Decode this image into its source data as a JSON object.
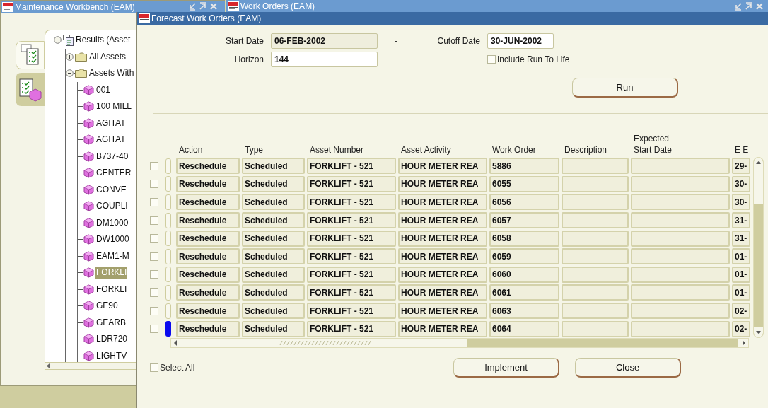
{
  "workbench_window": {
    "title": "Maintenance Workbench (EAM)",
    "side_tabs": [
      {
        "kind": "list",
        "selected": false
      },
      {
        "kind": "asset",
        "selected": true
      }
    ],
    "tree": [
      {
        "label": "Results (Asset",
        "kind": "results",
        "expanded": true,
        "children": [
          {
            "label": "All Assets",
            "kind": "folder",
            "expanded": false
          },
          {
            "label": "Assets With",
            "kind": "folder",
            "expanded": true,
            "children": [
              {
                "label": "001",
                "kind": "asset",
                "selected": false
              },
              {
                "label": "100 MILL",
                "kind": "asset",
                "selected": false
              },
              {
                "label": "AGITAT",
                "kind": "asset",
                "selected": false
              },
              {
                "label": "AGITAT",
                "kind": "asset",
                "selected": false
              },
              {
                "label": "B737-40",
                "kind": "asset",
                "selected": false
              },
              {
                "label": "CENTER",
                "kind": "asset",
                "selected": false
              },
              {
                "label": "CONVE",
                "kind": "asset",
                "selected": false
              },
              {
                "label": "COUPLI",
                "kind": "asset",
                "selected": false
              },
              {
                "label": "DM1000",
                "kind": "asset",
                "selected": false
              },
              {
                "label": "DW1000",
                "kind": "asset",
                "selected": false
              },
              {
                "label": "EAM1-M",
                "kind": "asset",
                "selected": false
              },
              {
                "label": "FORKLI",
                "kind": "asset",
                "selected": true
              },
              {
                "label": "FORKLI",
                "kind": "asset",
                "selected": false
              },
              {
                "label": "GE90",
                "kind": "asset",
                "selected": false
              },
              {
                "label": "GEARB",
                "kind": "asset",
                "selected": false
              },
              {
                "label": "LDR720",
                "kind": "asset",
                "selected": false
              },
              {
                "label": "LIGHTV",
                "kind": "asset",
                "selected": false
              }
            ]
          }
        ]
      }
    ]
  },
  "work_orders_window": {
    "title": "Work Orders (EAM)"
  },
  "forecast_window": {
    "title": "Forecast Work Orders (EAM)",
    "start_date": {
      "label": "Start Date",
      "value": "06-FEB-2002",
      "disabled": true
    },
    "range_dash": "-",
    "cutoff_date": {
      "label": "Cutoff Date",
      "value": "30-JUN-2002",
      "disabled": false
    },
    "horizon": {
      "label": "Horizon",
      "value": "144",
      "disabled": false
    },
    "include_run_to_life": {
      "label": "Include Run To Life",
      "checked": false
    },
    "run_button": {
      "label": "Run"
    },
    "table": {
      "columns": [
        "Action",
        "Type",
        "Asset Number",
        "Asset Activity",
        "Work Order",
        "Description",
        "Expected Start Date",
        "E E"
      ],
      "rows": [
        {
          "checked": false,
          "current": false,
          "cells": [
            "Reschedule",
            "Scheduled",
            "FORKLIFT - 521",
            "HOUR METER REA",
            "5886",
            "",
            "",
            "29-"
          ]
        },
        {
          "checked": false,
          "current": false,
          "cells": [
            "Reschedule",
            "Scheduled",
            "FORKLIFT - 521",
            "HOUR METER REA",
            "6055",
            "",
            "",
            "30-"
          ]
        },
        {
          "checked": false,
          "current": false,
          "cells": [
            "Reschedule",
            "Scheduled",
            "FORKLIFT - 521",
            "HOUR METER REA",
            "6056",
            "",
            "",
            "30-"
          ]
        },
        {
          "checked": false,
          "current": false,
          "cells": [
            "Reschedule",
            "Scheduled",
            "FORKLIFT - 521",
            "HOUR METER REA",
            "6057",
            "",
            "",
            "31-"
          ]
        },
        {
          "checked": false,
          "current": false,
          "cells": [
            "Reschedule",
            "Scheduled",
            "FORKLIFT - 521",
            "HOUR METER REA",
            "6058",
            "",
            "",
            "31-"
          ]
        },
        {
          "checked": false,
          "current": false,
          "cells": [
            "Reschedule",
            "Scheduled",
            "FORKLIFT - 521",
            "HOUR METER REA",
            "6059",
            "",
            "",
            "01-"
          ]
        },
        {
          "checked": false,
          "current": false,
          "cells": [
            "Reschedule",
            "Scheduled",
            "FORKLIFT - 521",
            "HOUR METER REA",
            "6060",
            "",
            "",
            "01-"
          ]
        },
        {
          "checked": false,
          "current": false,
          "cells": [
            "Reschedule",
            "Scheduled",
            "FORKLIFT - 521",
            "HOUR METER REA",
            "6061",
            "",
            "",
            "01-"
          ]
        },
        {
          "checked": false,
          "current": false,
          "cells": [
            "Reschedule",
            "Scheduled",
            "FORKLIFT - 521",
            "HOUR METER REA",
            "6063",
            "",
            "",
            "02-"
          ]
        },
        {
          "checked": false,
          "current": true,
          "cells": [
            "Reschedule",
            "Scheduled",
            "FORKLIFT - 521",
            "HOUR METER REA",
            "6064",
            "",
            "",
            "02-"
          ]
        }
      ]
    },
    "select_all": {
      "label": "Select All",
      "checked": false
    },
    "buttons": [
      {
        "label": "Implement"
      },
      {
        "label": "Close"
      }
    ]
  }
}
